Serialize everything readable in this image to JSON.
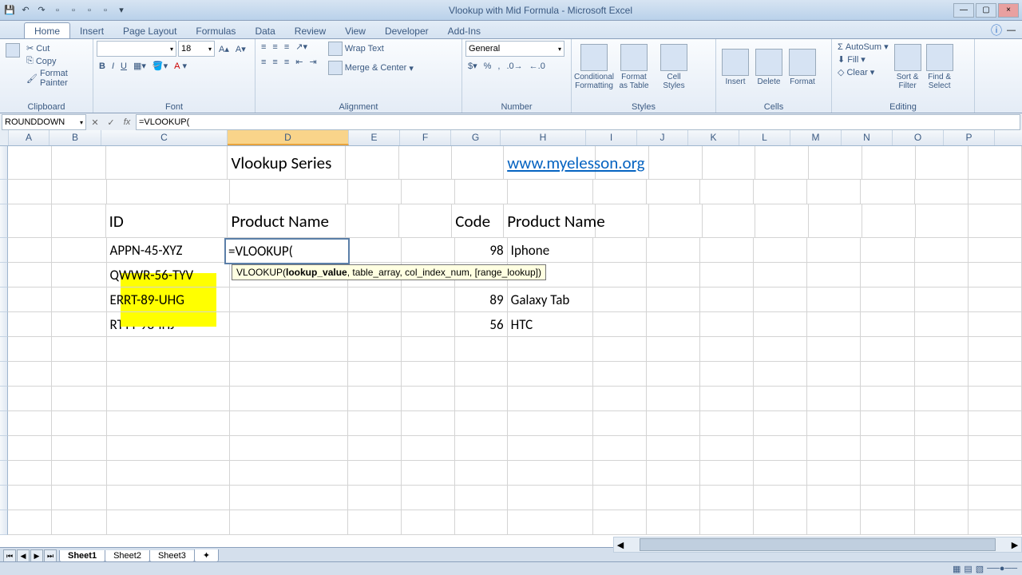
{
  "title": "Vlookup with Mid Formula - Microsoft Excel",
  "tabs": [
    "Home",
    "Insert",
    "Page Layout",
    "Formulas",
    "Data",
    "Review",
    "View",
    "Developer",
    "Add-Ins"
  ],
  "active_tab": 0,
  "clipboard": {
    "cut": "Cut",
    "copy": "Copy",
    "painter": "Format Painter",
    "label": "Clipboard"
  },
  "font": {
    "name": "",
    "size": "18",
    "label": "Font"
  },
  "alignment": {
    "wrap": "Wrap Text",
    "merge": "Merge & Center",
    "label": "Alignment"
  },
  "number": {
    "format": "General",
    "label": "Number"
  },
  "styles": {
    "cond": "Conditional\nFormatting",
    "table": "Format\nas Table",
    "cell": "Cell\nStyles",
    "label": "Styles"
  },
  "cells": {
    "insert": "Insert",
    "delete": "Delete",
    "format": "Format",
    "label": "Cells"
  },
  "editing": {
    "autosum": "AutoSum",
    "fill": "Fill",
    "clear": "Clear",
    "sort": "Sort &\nFilter",
    "find": "Find &\nSelect",
    "label": "Editing"
  },
  "namebox": "ROUNDDOWN",
  "formula": "=VLOOKUP(",
  "columns": [
    "A",
    "B",
    "C",
    "D",
    "E",
    "F",
    "G",
    "H",
    "I",
    "J",
    "K",
    "L",
    "M",
    "N",
    "O",
    "P"
  ],
  "selected_col": 3,
  "sheet": {
    "title": "Vlookup Series",
    "url": "www.myelesson.org",
    "hdr_id": "ID",
    "hdr_prod": "Product Name",
    "hdr_code": "Code",
    "hdr_prod2": "Product Name",
    "rows": [
      {
        "id": "APPN-45-XYZ",
        "code": "98",
        "prod": "Iphone"
      },
      {
        "id": "QWWR-56-TYV",
        "code": "",
        "prod": ""
      },
      {
        "id": "ERRT-89-UHG",
        "code": "89",
        "prod": "Galaxy Tab"
      },
      {
        "id": "RTTY-98-IHJ",
        "code": "56",
        "prod": "HTC"
      }
    ],
    "edit_cell": "=VLOOKUP(",
    "tooltip": "VLOOKUP(lookup_value, table_array, col_index_num, [range_lookup])",
    "tooltip_bold": "lookup_value"
  },
  "sheets": [
    "Sheet1",
    "Sheet2",
    "Sheet3"
  ],
  "active_sheet": 0
}
